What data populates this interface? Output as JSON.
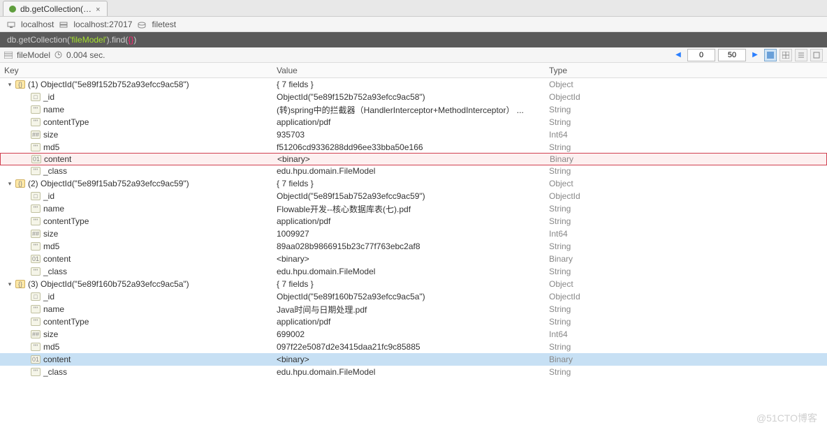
{
  "tab": {
    "label": "db.getCollection(…"
  },
  "breadcrumb": {
    "host": "localhost",
    "server": "localhost:27017",
    "db": "filetest"
  },
  "query": {
    "prefix": "db.getCollection(",
    "arg": "'fileModel'",
    "mid": ").find(",
    "braces": "{}",
    "suffix": ")"
  },
  "status": {
    "collection": "fileModel",
    "timing": "0.004 sec."
  },
  "pager": {
    "offset": "0",
    "limit": "50"
  },
  "columns": {
    "key": "Key",
    "value": "Value",
    "type": "Type"
  },
  "rows": [
    {
      "indent": 0,
      "expander": "v",
      "icon": "obj",
      "key": "(1) ObjectId(\"5e89f152b752a93efcc9ac58\")",
      "value": "{ 7 fields }",
      "type": "Object"
    },
    {
      "indent": 1,
      "icon": "id",
      "key": "_id",
      "value": "ObjectId(\"5e89f152b752a93efcc9ac58\")",
      "type": "ObjectId"
    },
    {
      "indent": 1,
      "icon": "str",
      "key": "name",
      "value": "(转)spring中的拦截器（HandlerInterceptor+MethodInterceptor） ...",
      "type": "String"
    },
    {
      "indent": 1,
      "icon": "str",
      "key": "contentType",
      "value": "application/pdf",
      "type": "String"
    },
    {
      "indent": 1,
      "icon": "num",
      "key": "size",
      "value": "935703",
      "type": "Int64"
    },
    {
      "indent": 1,
      "icon": "str",
      "key": "md5",
      "value": "f51206cd9336288dd96ee33bba50e166",
      "type": "String"
    },
    {
      "indent": 1,
      "icon": "bin",
      "key": "content",
      "value": "<binary>",
      "type": "Binary",
      "highlighted": true
    },
    {
      "indent": 1,
      "icon": "str",
      "key": "_class",
      "value": "edu.hpu.domain.FileModel",
      "type": "String"
    },
    {
      "indent": 0,
      "expander": "v",
      "icon": "obj",
      "key": "(2) ObjectId(\"5e89f15ab752a93efcc9ac59\")",
      "value": "{ 7 fields }",
      "type": "Object"
    },
    {
      "indent": 1,
      "icon": "id",
      "key": "_id",
      "value": "ObjectId(\"5e89f15ab752a93efcc9ac59\")",
      "type": "ObjectId"
    },
    {
      "indent": 1,
      "icon": "str",
      "key": "name",
      "value": "Flowable开发--核心数据库表(七).pdf",
      "type": "String"
    },
    {
      "indent": 1,
      "icon": "str",
      "key": "contentType",
      "value": "application/pdf",
      "type": "String"
    },
    {
      "indent": 1,
      "icon": "num",
      "key": "size",
      "value": "1009927",
      "type": "Int64"
    },
    {
      "indent": 1,
      "icon": "str",
      "key": "md5",
      "value": "89aa028b9866915b23c77f763ebc2af8",
      "type": "String"
    },
    {
      "indent": 1,
      "icon": "bin",
      "key": "content",
      "value": "<binary>",
      "type": "Binary"
    },
    {
      "indent": 1,
      "icon": "str",
      "key": "_class",
      "value": "edu.hpu.domain.FileModel",
      "type": "String"
    },
    {
      "indent": 0,
      "expander": "v",
      "icon": "obj",
      "key": "(3) ObjectId(\"5e89f160b752a93efcc9ac5a\")",
      "value": "{ 7 fields }",
      "type": "Object"
    },
    {
      "indent": 1,
      "icon": "id",
      "key": "_id",
      "value": "ObjectId(\"5e89f160b752a93efcc9ac5a\")",
      "type": "ObjectId"
    },
    {
      "indent": 1,
      "icon": "str",
      "key": "name",
      "value": "Java时间与日期处理.pdf",
      "type": "String"
    },
    {
      "indent": 1,
      "icon": "str",
      "key": "contentType",
      "value": "application/pdf",
      "type": "String"
    },
    {
      "indent": 1,
      "icon": "num",
      "key": "size",
      "value": "699002",
      "type": "Int64"
    },
    {
      "indent": 1,
      "icon": "str",
      "key": "md5",
      "value": "097f22e5087d2e3415daa21fc9c85885",
      "type": "String"
    },
    {
      "indent": 1,
      "icon": "bin",
      "key": "content",
      "value": "<binary>",
      "type": "Binary",
      "selected": true
    },
    {
      "indent": 1,
      "icon": "str",
      "key": "_class",
      "value": "edu.hpu.domain.FileModel",
      "type": "String"
    }
  ],
  "watermark": "@51CTO博客"
}
